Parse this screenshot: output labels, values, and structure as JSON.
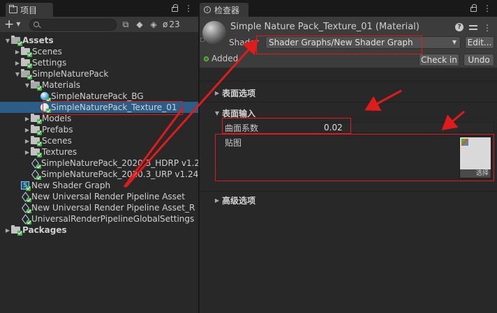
{
  "project": {
    "tab_label": "项目",
    "hidden_count": "23",
    "tree": [
      {
        "label": "Assets",
        "indent": 0,
        "arrow": "down",
        "icon": "folder-open",
        "bold": true
      },
      {
        "label": "Scenes",
        "indent": 1,
        "arrow": "right",
        "icon": "folder"
      },
      {
        "label": "Settings",
        "indent": 1,
        "arrow": "right",
        "icon": "folder"
      },
      {
        "label": "SimpleNaturePack",
        "indent": 1,
        "arrow": "down",
        "icon": "folder-open"
      },
      {
        "label": "Materials",
        "indent": 2,
        "arrow": "down",
        "icon": "folder-open"
      },
      {
        "label": "SimpleNaturePack_BG",
        "indent": 3,
        "arrow": "",
        "icon": "material-blue"
      },
      {
        "label": "SimpleNaturePack_Texture_01",
        "indent": 3,
        "arrow": "",
        "icon": "material-light",
        "selected": true
      },
      {
        "label": "Models",
        "indent": 2,
        "arrow": "right",
        "icon": "folder"
      },
      {
        "label": "Prefabs",
        "indent": 2,
        "arrow": "right",
        "icon": "folder"
      },
      {
        "label": "Scenes",
        "indent": 2,
        "arrow": "right",
        "icon": "folder"
      },
      {
        "label": "Textures",
        "indent": 2,
        "arrow": "right",
        "icon": "folder"
      },
      {
        "label": "SimpleNaturePack_2020.3_HDRP v1.2",
        "indent": 2,
        "arrow": "",
        "icon": "package"
      },
      {
        "label": "SimpleNaturePack_2020.3_URP v1.24",
        "indent": 2,
        "arrow": "",
        "icon": "package"
      },
      {
        "label": "New Shader Graph",
        "indent": 1,
        "arrow": "",
        "icon": "shader-graph"
      },
      {
        "label": "New Universal Render Pipeline Asset",
        "indent": 1,
        "arrow": "",
        "icon": "asset"
      },
      {
        "label": "New Universal Render Pipeline Asset_R",
        "indent": 1,
        "arrow": "",
        "icon": "asset"
      },
      {
        "label": "UniversalRenderPipelineGlobalSettings",
        "indent": 1,
        "arrow": "",
        "icon": "asset"
      },
      {
        "label": "Packages",
        "indent": 0,
        "arrow": "right",
        "icon": "folder",
        "bold": true
      }
    ]
  },
  "inspector": {
    "tab_label": "检查器",
    "material_title": "Simple Nature Pack_Texture_01 (Material)",
    "shader_label": "Shader",
    "shader_value": "Shader Graphs/New Shader Graph",
    "edit_label": "Edit...",
    "added_label": "Added",
    "checkin_label": "Check in",
    "undo_label": "Undo",
    "surface_options": "表面选项",
    "surface_inputs": "表面输入",
    "curvature_label": "曲面系数",
    "curvature_value": "0.02",
    "texture_label": "贴图",
    "texture_select": "选择",
    "advanced_options": "高级选项"
  },
  "colors": {
    "selection": "#2c5d87",
    "annotation_red": "#e01b1b"
  }
}
